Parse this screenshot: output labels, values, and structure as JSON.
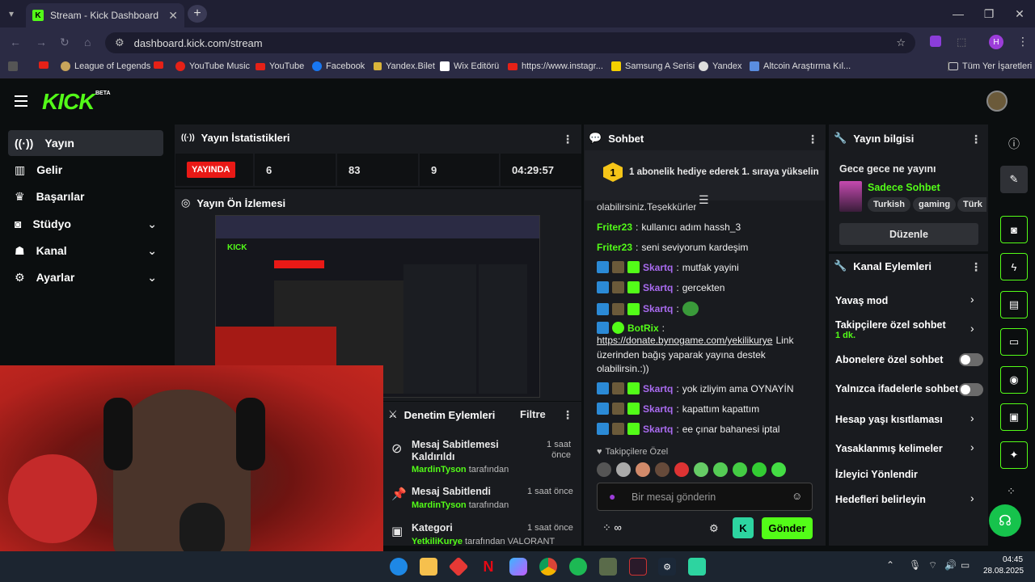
{
  "browser": {
    "tab_title": "Stream - Kick Dashboard",
    "url": "dashboard.kick.com/stream",
    "profile_initial": "H",
    "bookmarks": [
      "League of Legends",
      "YouTube Music",
      "YouTube",
      "Facebook",
      "Yandex.Bilet",
      "Wix Editörü",
      "https://www.instagr...",
      "Samsung A Serisi",
      "Yandex",
      "Altcoin Araştırma Kıl...",
      "Tüm Yer İşaretleri"
    ]
  },
  "kick": {
    "logo": "KICK",
    "beta": "BETA",
    "nav": [
      "Yayın",
      "Gelir",
      "Başarılar",
      "Stüdyo",
      "Kanal",
      "Ayarlar"
    ]
  },
  "stats": {
    "title": "Yayın İstatistikleri",
    "live": "YAYINDA",
    "values": [
      "6",
      "83",
      "9",
      "04:29:57"
    ]
  },
  "preview": {
    "title": "Yayın Ön İzlemesi"
  },
  "moderation": {
    "title": "Denetim Eylemleri",
    "filter": "Filtre",
    "items": [
      {
        "action": "Mesaj Sabitlemesi Kaldırıldı",
        "user": "MardinTyson",
        "by": "tarafından",
        "time": "1 saat önce"
      },
      {
        "action": "Mesaj Sabitlendi",
        "user": "MardinTyson",
        "by": "tarafından",
        "time": "1 saat önce"
      },
      {
        "action": "Kategori",
        "user": "YetkiliKurye",
        "by": "tarafından VALORANT",
        "time": "1 saat önce"
      }
    ]
  },
  "chat": {
    "title": "Sohbet",
    "gift_banner": "1 abonelik hediye ederek 1. sıraya yükselin",
    "gift_rank": "1",
    "partial_top": "olabilirsiniz.Teşekkürler",
    "messages": [
      {
        "user": "Friter23",
        "text": "kullanıcı adım hassh_3"
      },
      {
        "user": "Friter23",
        "text": "seni seviyorum kardeşim"
      },
      {
        "user": "Skartq",
        "text": "mutfak yayini"
      },
      {
        "user": "Skartq",
        "text": "gercekten"
      },
      {
        "user": "Skartq",
        "text": ""
      },
      {
        "user": "BotRix",
        "text": "https://donate.bynogame.com/yekilikurye",
        "text2": " Link",
        "text3": "üzerinden bağış yaparak yayına destek",
        "text4": "olabilirsin.:))"
      },
      {
        "user": "Skartq",
        "text": "yok izliyim ama OYNAYİN"
      },
      {
        "user": "Skartq",
        "text": "kapattım kapattım"
      },
      {
        "user": "Skartq",
        "text": "ee çınar bahanesi iptal"
      }
    ],
    "followers_label": "Takipçilere Özel",
    "input_placeholder": "Bir mesaj gönderin",
    "send": "Gönder"
  },
  "stream_info": {
    "title": "Yayın bilgisi",
    "stream_title": "Gece gece ne yayını",
    "category": "Sadece Sohbet",
    "tags": [
      "Turkish",
      "gaming",
      "Türk"
    ],
    "edit": "Düzenle"
  },
  "channel_actions": {
    "title": "Kanal Eylemleri",
    "rows": [
      "Yavaş mod",
      "Takipçilere özel sohbet",
      "Abonelere özel sohbet",
      "Yalnızca ifadelerle sohbet",
      "Hesap yaşı kısıtlaması",
      "Yasaklanmış kelimeler",
      "İzleyici Yönlendir",
      "Hedefleri belirleyin"
    ],
    "followers_sub": "1 dk."
  },
  "taskbar": {
    "time": "04:45",
    "date": "28.08.2025"
  },
  "colors": {
    "accent": "#53fc18",
    "live": "#e91916",
    "panel": "#191b1f"
  }
}
